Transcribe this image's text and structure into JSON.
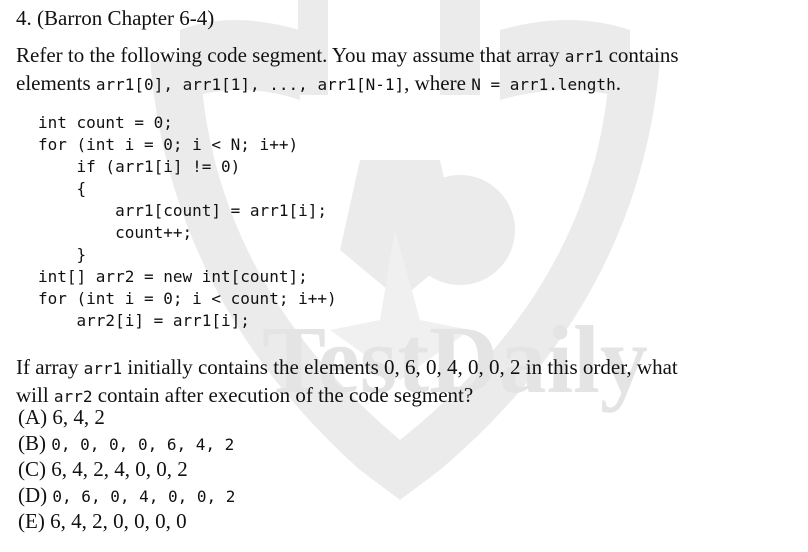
{
  "heading": "4. (Barron Chapter 6-4)",
  "intro": {
    "l1a": "Refer to the following code segment. You may assume that array ",
    "l1b": "arr1",
    "l1c": " contains",
    "l2a": "elements ",
    "l2b": "arr1[0], arr1[1], ..., arr1[N-1]",
    "l2c": ", where ",
    "l2d": "N = arr1.length",
    "l2e": "."
  },
  "code": [
    "int count = 0;",
    "for (int i = 0; i < N; i++)",
    "    if (arr1[i] != 0)",
    "    {",
    "        arr1[count] = arr1[i];",
    "        count++;",
    "    }",
    "int[] arr2 = new int[count];",
    "for (int i = 0; i < count; i++)",
    "    arr2[i] = arr1[i];"
  ],
  "question": {
    "l1a": "If array ",
    "l1b": "arr1",
    "l1c": " initially contains the elements 0, 6, 0, 4, 0, 0, 2 in this order, what",
    "l2a": "will ",
    "l2b": "arr2",
    "l2c": " contain after execution of the code segment?"
  },
  "choices": [
    {
      "letter": "(A)",
      "values": "6, 4, 2"
    },
    {
      "letter": "(B)",
      "values": "0, 0, 0, 0, 6, 4, 2"
    },
    {
      "letter": "(C)",
      "values": "6, 4, 2, 4, 0, 0, 2"
    },
    {
      "letter": "(D)",
      "values": "0, 6, 0, 4, 0, 0, 2"
    },
    {
      "letter": "(E)",
      "values": "6, 4, 2, 0, 0, 0, 0"
    }
  ],
  "watermark": {
    "text": "TestDaily",
    "color": "#e4e4e4"
  }
}
